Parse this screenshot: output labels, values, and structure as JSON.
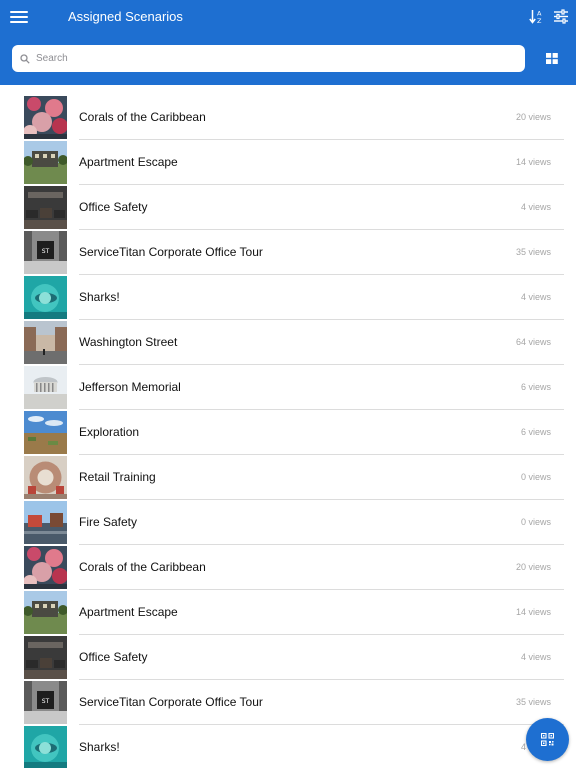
{
  "header": {
    "title": "Assigned Scenarios",
    "menu_icon": "menu-icon",
    "sort_icon": "sort-icon",
    "filter_icon": "filter-icon",
    "bg_color": "#1e6fd1"
  },
  "search": {
    "placeholder": "Search",
    "value": "",
    "view_toggle_icon": "grid-view-icon"
  },
  "scenarios": [
    {
      "title": "Corals of the Caribbean",
      "views": "20 views",
      "thumb": "coral"
    },
    {
      "title": "Apartment Escape",
      "views": "14 views",
      "thumb": "apartment"
    },
    {
      "title": "Office Safety",
      "views": "4 views",
      "thumb": "office"
    },
    {
      "title": "ServiceTitan Corporate Office Tour",
      "views": "35 views",
      "thumb": "corporate"
    },
    {
      "title": "Sharks!",
      "views": "4 views",
      "thumb": "sharks"
    },
    {
      "title": "Washington Street",
      "views": "64 views",
      "thumb": "street"
    },
    {
      "title": "Jefferson Memorial",
      "views": "6 views",
      "thumb": "memorial"
    },
    {
      "title": "Exploration",
      "views": "6 views",
      "thumb": "exploration"
    },
    {
      "title": "Retail Training",
      "views": "0 views",
      "thumb": "retail"
    },
    {
      "title": "Fire Safety",
      "views": "0 views",
      "thumb": "fire"
    },
    {
      "title": "Corals of the Caribbean",
      "views": "20 views",
      "thumb": "coral"
    },
    {
      "title": "Apartment Escape",
      "views": "14 views",
      "thumb": "apartment"
    },
    {
      "title": "Office Safety",
      "views": "4 views",
      "thumb": "office"
    },
    {
      "title": "ServiceTitan Corporate Office Tour",
      "views": "35 views",
      "thumb": "corporate"
    },
    {
      "title": "Sharks!",
      "views": "4 views",
      "thumb": "sharks"
    }
  ],
  "fab": {
    "icon": "qr-code-icon"
  }
}
